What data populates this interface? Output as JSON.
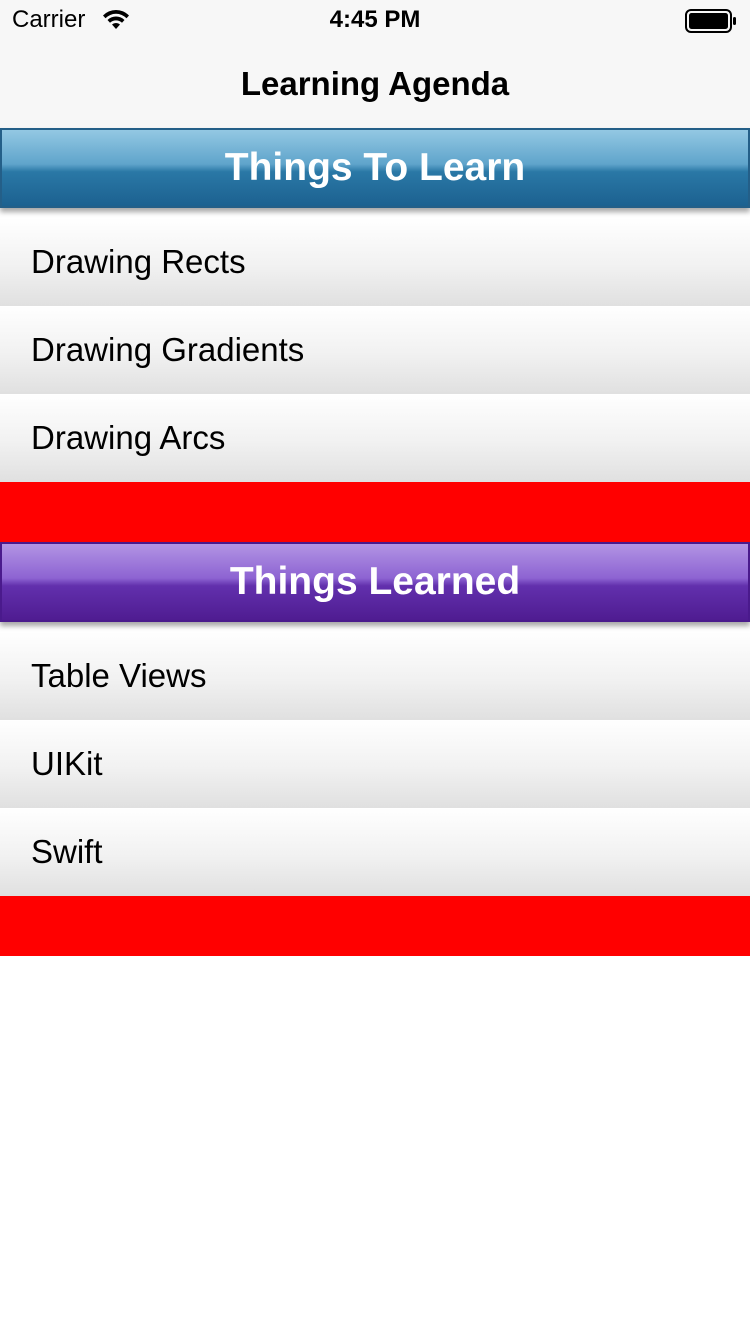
{
  "status_bar": {
    "carrier": "Carrier",
    "time": "4:45 PM",
    "icons": [
      "wifi-icon",
      "battery-icon"
    ]
  },
  "nav": {
    "title": "Learning Agenda"
  },
  "sections": [
    {
      "title": "Things To Learn",
      "header_color": "#2a78a6",
      "rows": [
        "Drawing Rects",
        "Drawing Gradients",
        "Drawing Arcs"
      ]
    },
    {
      "title": "Things Learned",
      "header_color": "#6230ad",
      "rows": [
        "Table Views",
        "UIKit",
        "Swift"
      ]
    }
  ],
  "colors": {
    "footer": "#ff0000",
    "nav_background": "#f7f7f7",
    "background": "#ffffff"
  }
}
